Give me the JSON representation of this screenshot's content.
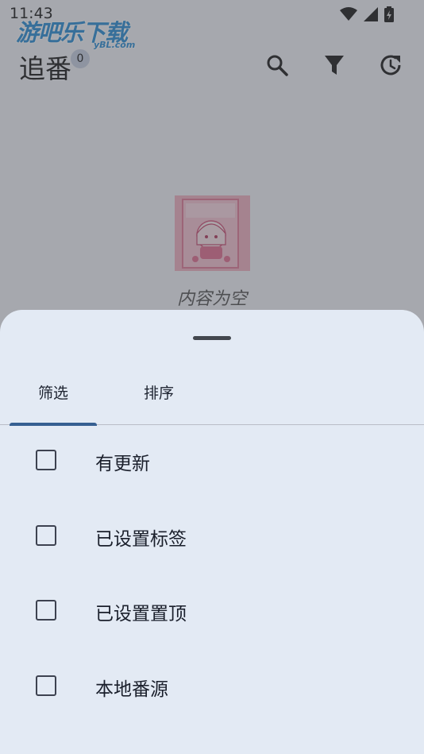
{
  "status_bar": {
    "time": "11:43"
  },
  "watermark": {
    "text": "游吧乐下载",
    "sub": "yBL.com"
  },
  "header": {
    "title": "追番",
    "badge_count": "0",
    "actions": [
      {
        "icon": "search-icon"
      },
      {
        "icon": "filter-icon"
      },
      {
        "icon": "history-icon"
      }
    ]
  },
  "main": {
    "empty_text": "内容为空"
  },
  "sheet": {
    "tabs": [
      {
        "label": "筛选",
        "selected": true
      },
      {
        "label": "排序",
        "selected": false
      }
    ],
    "options": [
      {
        "label": "有更新",
        "checked": false
      },
      {
        "label": "已设置标签",
        "checked": false
      },
      {
        "label": "已设置置顶",
        "checked": false
      },
      {
        "label": "本地番源",
        "checked": false
      }
    ]
  },
  "colors": {
    "sheet_background": "#e3eaf4",
    "tab_indicator": "#365f91",
    "scrim": "#464a50"
  }
}
